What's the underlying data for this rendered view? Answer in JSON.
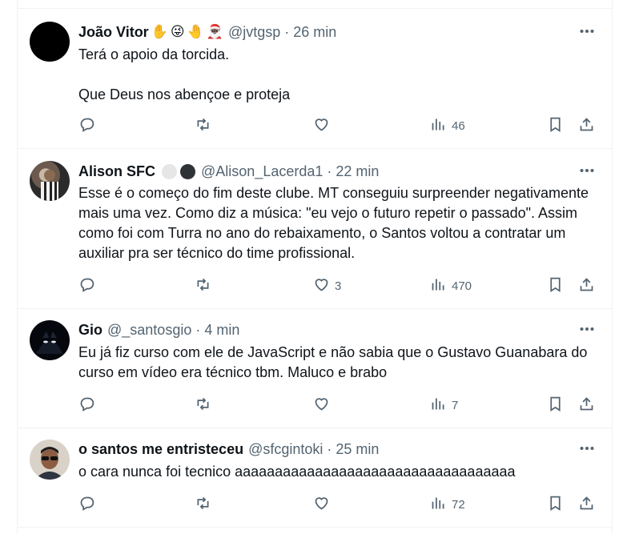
{
  "tweets": [
    {
      "name": "João Vitor",
      "emojis": [
        "✋",
        "😜",
        "🤚",
        "🎅🏿"
      ],
      "handle": "@jvtgsp",
      "time": "26 min",
      "text": "Terá o apoio da torcida.\n\nQue Deus nos abençoe e proteja",
      "replies": "",
      "reposts": "",
      "likes": "",
      "views": "46"
    },
    {
      "name": "Alison SFC",
      "badge_colors": [
        "#e6e6e6",
        "#2f3336"
      ],
      "handle": "@Alison_Lacerda1",
      "time": "22 min",
      "text": "Esse é o começo do fim deste clube. MT conseguiu surpreender negativamente mais uma vez. Como diz a música: \"eu vejo o futuro repetir o passado\". Assim como foi com Turra no ano do rebaixamento, o Santos voltou a contratar um auxiliar pra ser técnico do time profissional.",
      "replies": "",
      "reposts": "",
      "likes": "3",
      "views": "470"
    },
    {
      "name": "Gio",
      "handle": "@_santosgio",
      "time": "4 min",
      "text": "Eu já fiz curso com ele de JavaScript e não sabia que o Gustavo Guanabara do curso em vídeo era técnico tbm. Maluco e brabo",
      "replies": "",
      "reposts": "",
      "likes": "",
      "views": "7"
    },
    {
      "name": "o santos me entristeceu",
      "handle": "@sfcgintoki",
      "time": "25 min",
      "text": "o cara nunca foi tecnico aaaaaaaaaaaaaaaaaaaaaaaaaaaaaaaaaaa",
      "replies": "",
      "reposts": "",
      "likes": "",
      "views": "72"
    }
  ],
  "icons": {
    "reply": "reply-icon",
    "repost": "repost-icon",
    "like": "like-icon",
    "views": "views-icon",
    "bookmark": "bookmark-icon",
    "share": "share-icon",
    "more": "more-icon"
  },
  "colors": {
    "text": "#0f1419",
    "muted": "#536471",
    "border": "#eff3f4"
  }
}
